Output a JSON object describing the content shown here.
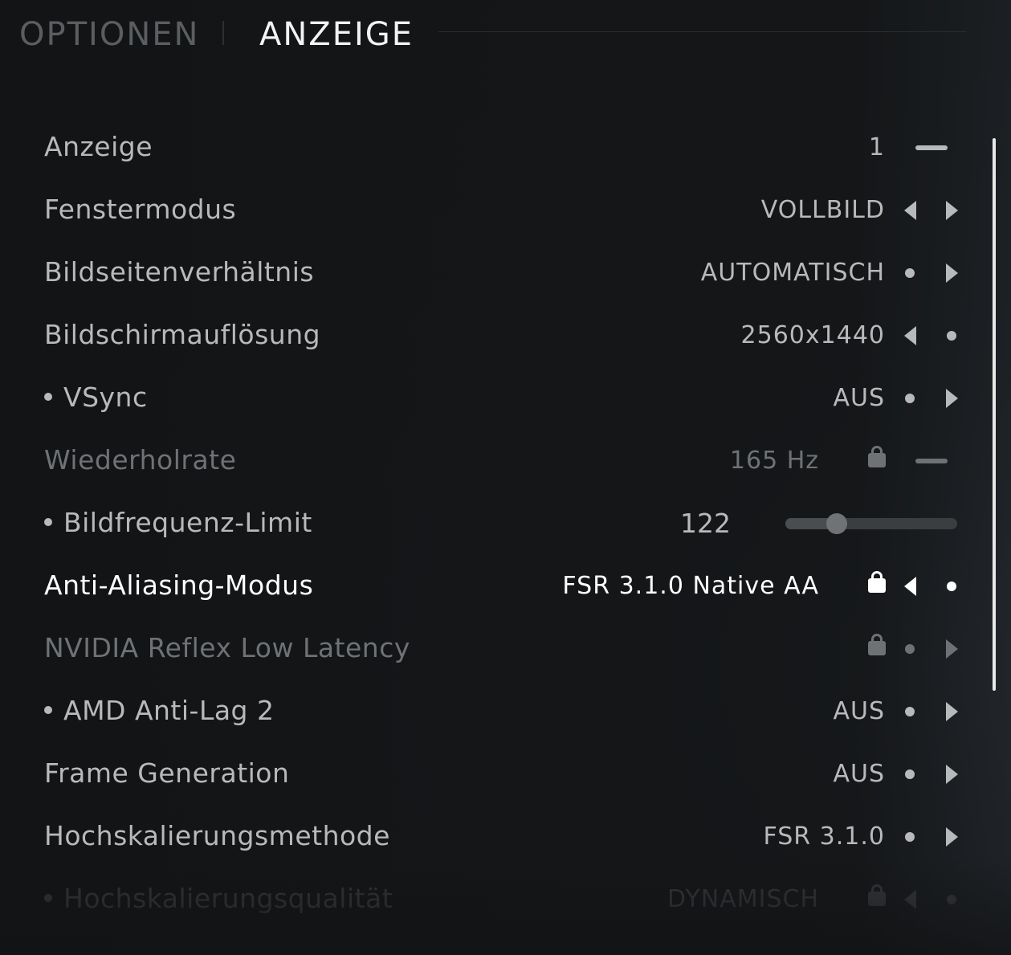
{
  "header": {
    "options_tab": "OPTIONEN",
    "display_tab": "ANZEIGE"
  },
  "settings": [
    {
      "label": "Anzeige",
      "value": "1",
      "bullet": false,
      "state": "default",
      "locked": false,
      "left": "none",
      "right": "dash"
    },
    {
      "label": "Fenstermodus",
      "value": "VOLLBILD",
      "bullet": false,
      "state": "default",
      "locked": false,
      "left": "arrow",
      "right": "arrow"
    },
    {
      "label": "Bildseitenverhältnis",
      "value": "AUTOMATISCH",
      "bullet": false,
      "state": "default",
      "locked": false,
      "left": "dot",
      "right": "arrow"
    },
    {
      "label": "Bildschirmauflösung",
      "value": "2560x1440",
      "bullet": false,
      "state": "default",
      "locked": false,
      "left": "arrow",
      "right": "dot"
    },
    {
      "label": "VSync",
      "value": "AUS",
      "bullet": true,
      "state": "default",
      "locked": false,
      "left": "dot",
      "right": "arrow"
    },
    {
      "label": "Wiederholrate",
      "value": "165 Hz",
      "bullet": false,
      "state": "disabled",
      "locked": true,
      "left": "none",
      "right": "dash"
    },
    {
      "label": "Bildfrequenz-Limit",
      "value": "122",
      "bullet": true,
      "state": "default",
      "locked": false,
      "control": "slider",
      "slider_fraction": 0.3
    },
    {
      "label": "Anti-Aliasing-Modus",
      "value": "FSR 3.1.0 Native AA",
      "bullet": false,
      "state": "active",
      "locked": true,
      "left": "arrow",
      "right": "dot"
    },
    {
      "label": "NVIDIA Reflex Low Latency",
      "value": "",
      "bullet": false,
      "state": "disabled",
      "locked": true,
      "left": "dot",
      "right": "arrow"
    },
    {
      "label": "AMD Anti-Lag 2",
      "value": "AUS",
      "bullet": true,
      "state": "default",
      "locked": false,
      "left": "dot",
      "right": "arrow"
    },
    {
      "label": "Frame Generation",
      "value": "AUS",
      "bullet": false,
      "state": "default",
      "locked": false,
      "left": "dot",
      "right": "arrow"
    },
    {
      "label": "Hochskalierungsmethode",
      "value": "FSR 3.1.0",
      "bullet": false,
      "state": "default",
      "locked": false,
      "left": "dot",
      "right": "arrow"
    },
    {
      "label": "Hochskalierungsqualität",
      "value": "DYNAMISCH",
      "bullet": true,
      "state": "faded",
      "locked": true,
      "left": "arrow",
      "right": "dot"
    }
  ]
}
